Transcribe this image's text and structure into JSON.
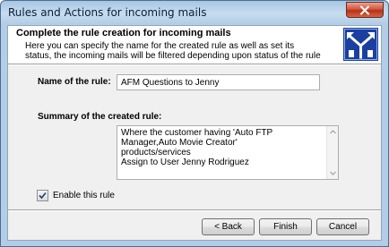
{
  "window": {
    "title": "Rules and Actions for incoming mails"
  },
  "header": {
    "title": "Complete the rule creation for incoming mails",
    "description": "Here you can specify the name for the created rule as well as set its status, the incoming mails will be filtered depending upon status of the rule",
    "icon": "branch-arrows-icon"
  },
  "form": {
    "name_label": "Name of the rule:",
    "name_value": "AFM Questions to Jenny",
    "summary_label": "Summary of the created rule:",
    "summary_lines": [
      "Where the customer having 'Auto FTP Manager,Auto Movie Creator'",
      "products/services",
      "Assign to User Jenny Rodriguez"
    ],
    "enable_label": "Enable this rule",
    "enable_checked": true
  },
  "buttons": {
    "back": "< Back",
    "finish": "Finish",
    "cancel": "Cancel"
  },
  "colors": {
    "title_bar": "#b3cde6",
    "close_button": "#c8452b",
    "icon_bg": "#1b3fa0"
  }
}
